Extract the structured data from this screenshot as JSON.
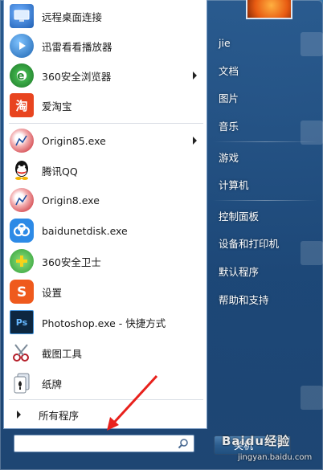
{
  "left_programs": [
    {
      "label": "远程桌面连接",
      "icon": "remote-desktop-icon",
      "color": "#2f6fb8"
    },
    {
      "label": "迅雷看看播放器",
      "icon": "xunlei-player-icon",
      "color": "#3d86c9"
    },
    {
      "label": "360安全浏览器",
      "icon": "360-browser-icon",
      "color": "#39a845"
    },
    {
      "label": "爱淘宝",
      "icon": "aitaobao-icon",
      "color": "#e43d1e"
    },
    {
      "label": "Origin85.exe",
      "icon": "origin-icon",
      "color": "#d9484e"
    },
    {
      "label": "腾讯QQ",
      "icon": "qq-icon",
      "color": "#111111"
    },
    {
      "label": "Origin8.exe",
      "icon": "origin-icon",
      "color": "#d9484e"
    },
    {
      "label": "baidunetdisk.exe",
      "icon": "baidu-netdisk-icon",
      "color": "#2d8ae6"
    },
    {
      "label": "360安全卫士",
      "icon": "360-safe-icon",
      "color": "#3bb34a"
    },
    {
      "label": "设置",
      "icon": "sogou-settings-icon",
      "color": "#ef5a1d"
    },
    {
      "label": "Photoshop.exe - 快捷方式",
      "icon": "photoshop-icon",
      "color": "#0f2a4a"
    },
    {
      "label": "截图工具",
      "icon": "snipping-tool-icon",
      "color": "#c4d2e2"
    },
    {
      "label": "纸牌",
      "icon": "solitaire-icon",
      "color": "#e9eef5"
    }
  ],
  "icon_texts": {
    "aitaobao": "淘",
    "photoshop": "Ps"
  },
  "all_programs_label": "所有程序",
  "search": {
    "value": "",
    "placeholder": ""
  },
  "right_items": [
    {
      "label": "jie"
    },
    {
      "label": "文档"
    },
    {
      "label": "图片"
    },
    {
      "label": "音乐"
    },
    {
      "label": "游戏"
    },
    {
      "label": "计算机"
    },
    {
      "label": "控制面板"
    },
    {
      "label": "设备和打印机"
    },
    {
      "label": "默认程序"
    },
    {
      "label": "帮助和支持"
    }
  ],
  "shutdown_label": "关机",
  "watermark": {
    "line1": "Baidu经验",
    "line2": "jingyan.baidu.com"
  }
}
